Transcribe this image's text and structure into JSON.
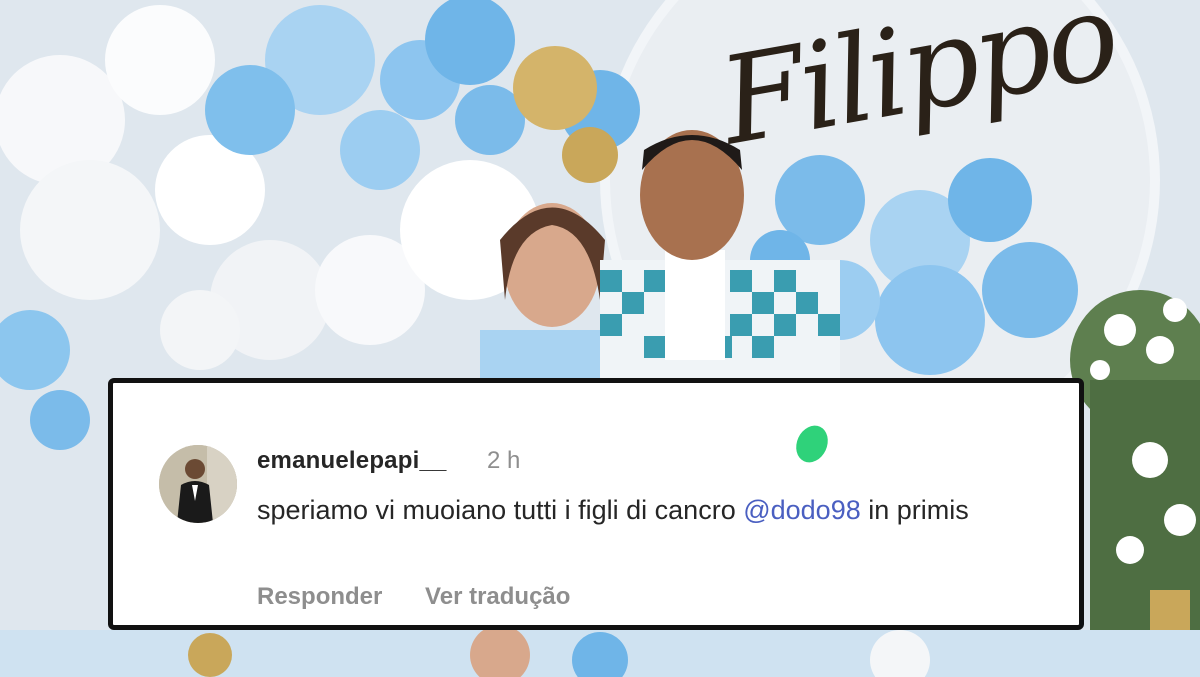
{
  "photo": {
    "banner_text": "Filippo",
    "balloon_colors": [
      "#6fb5e8",
      "#a9d3f2",
      "#ffffff",
      "#d4b46a"
    ]
  },
  "comment": {
    "username": "emanuelepapi__",
    "time": "2 h",
    "text_before": "speriamo vi muoiano tutti i figli di cancro ",
    "mention": "@dodo98",
    "text_after": " in primis",
    "reply_label": "Responder",
    "translate_label": "Ver tradução",
    "mention_color": "#4a5fc1"
  }
}
